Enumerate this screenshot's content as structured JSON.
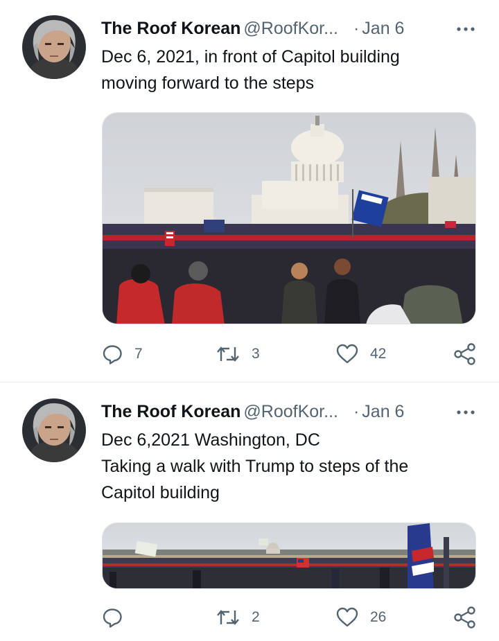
{
  "tweets": [
    {
      "author_name": "The Roof Korean",
      "handle": "@RoofKor...",
      "separator": "·",
      "date": "Jan 6",
      "text_lines": [
        "Dec 6, 2021, in front of Capitol building",
        "moving forward to the steps"
      ],
      "media_alt": "crowd with flags in front of Capitol building",
      "reply_count": "7",
      "retweet_count": "3",
      "like_count": "42"
    },
    {
      "author_name": "The Roof Korean",
      "handle": "@RoofKor...",
      "separator": "·",
      "date": "Jan 6",
      "text_lines": [
        "Dec 6,2021 Washington, DC",
        "Taking a walk with Trump to steps of the",
        "Capitol building"
      ],
      "media_alt": "panoramic crowd on the Mall with Capitol in distance",
      "reply_count": "",
      "retweet_count": "2",
      "like_count": "26"
    }
  ],
  "colors": {
    "text_primary": "#0f1419",
    "text_secondary": "#536471",
    "divider": "#e6ecf0"
  },
  "icons": [
    "reply-icon",
    "retweet-icon",
    "like-icon",
    "share-icon",
    "more-icon"
  ]
}
